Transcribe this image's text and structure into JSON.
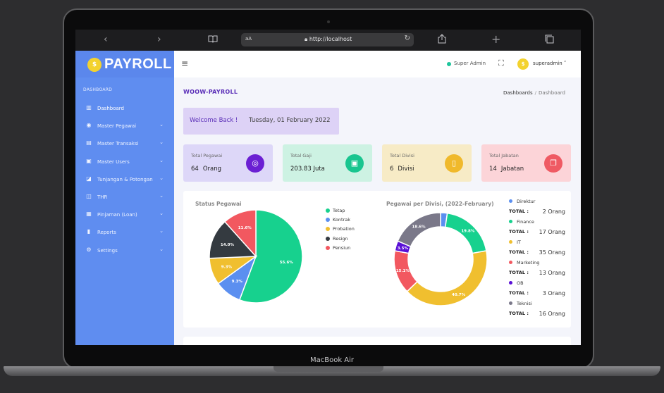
{
  "device": {
    "label": "MacBook Air"
  },
  "browser": {
    "back_icon": "chevron-left-icon",
    "forward_icon": "chevron-right-icon",
    "text_size": "aA",
    "url": "http://localhost"
  },
  "brand": {
    "name": "PAYROLL",
    "logo_text": "$"
  },
  "sidebar": {
    "section": "DASHBOARD",
    "items": [
      {
        "label": "Dashboard",
        "icon": "chart-icon",
        "chevron": false
      },
      {
        "label": "Master Pegawai",
        "icon": "user-circle-icon",
        "chevron": true
      },
      {
        "label": "Master Transaksi",
        "icon": "calendar-icon",
        "chevron": true
      },
      {
        "label": "Master Users",
        "icon": "user-box-icon",
        "chevron": true
      },
      {
        "label": "Tunjangan & Potongan",
        "icon": "trend-icon",
        "chevron": true
      },
      {
        "label": "THR",
        "icon": "bus-icon",
        "chevron": true
      },
      {
        "label": "Pinjaman (Loan)",
        "icon": "book-icon",
        "chevron": true
      },
      {
        "label": "Reports",
        "icon": "file-icon",
        "chevron": true
      },
      {
        "label": "Settings",
        "icon": "gear-icon",
        "chevron": true
      }
    ]
  },
  "topbar": {
    "role": "Super Admin",
    "username": "superadmin",
    "avatar_text": "$"
  },
  "page": {
    "title": "WOOW-PAYROLL",
    "breadcrumb": [
      "Dashboards",
      "Dashboard"
    ],
    "welcome": "Welcome Back !",
    "date": "Tuesday, 01 February 2022"
  },
  "stats": [
    {
      "title": "Total Pegawai",
      "value": "64",
      "unit": "Orang",
      "bg": "#ddd7f8",
      "icon_bg": "#6b1fd3",
      "icon": "user-icon"
    },
    {
      "title": "Total Gaji",
      "value": "203.83 Juta",
      "unit": "",
      "bg": "#cdf2e3",
      "icon_bg": "#19c58f",
      "icon": "money-icon"
    },
    {
      "title": "Total Divisi",
      "value": "6",
      "unit": "Divisi",
      "bg": "#f7ebc6",
      "icon_bg": "#f0b92b",
      "icon": "bookmark-icon"
    },
    {
      "title": "Total Jabatan",
      "value": "14",
      "unit": "Jabatan",
      "bg": "#fcd4d8",
      "icon_bg": "#ef5a63",
      "icon": "copy-icon"
    }
  ],
  "chart_data": [
    {
      "type": "pie",
      "title": "Status Pegawai",
      "categories": [
        "Tetap",
        "Kontrak",
        "Probation",
        "Resign",
        "Pensiun"
      ],
      "values": [
        55.6,
        9.3,
        9.3,
        14.0,
        11.6
      ],
      "labels": [
        "55.6%",
        "9.3%",
        "9.3%",
        "14.0%",
        "11.6%"
      ],
      "colors": [
        "#17d18e",
        "#5b8ff0",
        "#f0bf2f",
        "#343a40",
        "#f25860"
      ],
      "legend": "right"
    },
    {
      "type": "pie",
      "title": "Pegawai per Divisi, (2022-February)",
      "categories": [
        "Direktur",
        "Finance",
        "IT",
        "Marketing",
        "OB",
        "Teknisi"
      ],
      "values": [
        2,
        17,
        35,
        13,
        3,
        16
      ],
      "labels": [
        "",
        "19.8%",
        "40.7%",
        "15.1%",
        "3.5%",
        "18.6%"
      ],
      "colors": [
        "#5b8ff0",
        "#17d18e",
        "#f0bf2f",
        "#f25860",
        "#5a10d6",
        "#7a7889"
      ],
      "legend": "right",
      "total_label": "TOTAL :",
      "totals": [
        "2 Orang",
        "17 Orang",
        "35 Orang",
        "13 Orang",
        "3 Orang",
        "16 Orang"
      ]
    }
  ]
}
